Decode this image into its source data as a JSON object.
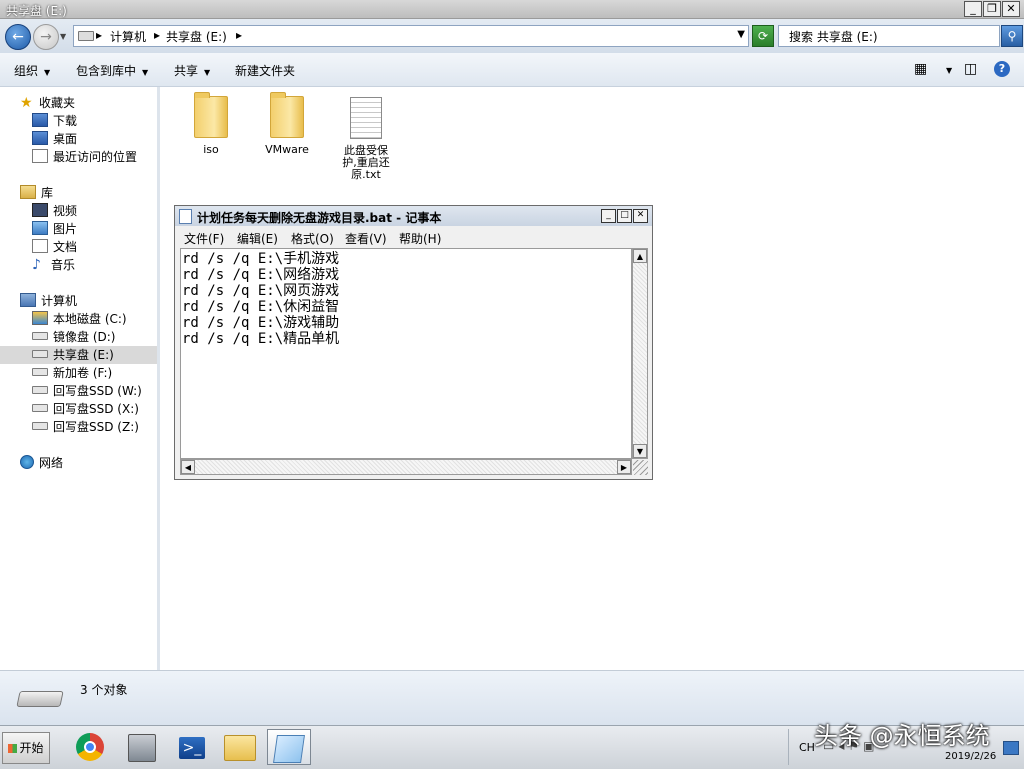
{
  "explorer": {
    "window_title": "共享盘 (E:)",
    "address": {
      "crumbs": [
        "计算机",
        "共享盘 (E:)"
      ]
    },
    "search_placeholder": "搜索 共享盘 (E:)",
    "toolbar": {
      "organize": "组织",
      "include_in_library": "包含到库中",
      "share": "共享",
      "new_folder": "新建文件夹"
    },
    "nav": {
      "favorites": "收藏夹",
      "favorites_items": [
        "下载",
        "桌面",
        "最近访问的位置"
      ],
      "libraries": "库",
      "library_items": [
        "视频",
        "图片",
        "文档",
        "音乐"
      ],
      "computer": "计算机",
      "drives": [
        "本地磁盘 (C:)",
        "镜像盘 (D:)",
        "共享盘 (E:)",
        "新加卷 (F:)",
        "回写盘SSD (W:)",
        "回写盘SSD (X:)",
        "回写盘SSD (Z:)"
      ],
      "selected_drive": "共享盘 (E:)",
      "network": "网络"
    },
    "files": [
      {
        "name": "iso",
        "type": "folder"
      },
      {
        "name": "VMware",
        "type": "folder"
      },
      {
        "name_lines": [
          "此盘受保",
          "护,重启还",
          "原.txt"
        ],
        "type": "text"
      }
    ],
    "status": {
      "item_count": "3 个对象"
    }
  },
  "notepad": {
    "title": "计划任务每天删除无盘游戏目录.bat - 记事本",
    "menu": [
      "文件(F)",
      "编辑(E)",
      "格式(O)",
      "查看(V)",
      "帮助(H)"
    ],
    "lines": [
      "rd /s /q E:\\手机游戏",
      "rd /s /q E:\\网络游戏",
      "rd /s /q E:\\网页游戏",
      "rd /s /q E:\\休闲益智",
      "rd /s /q E:\\游戏辅助",
      "rd /s /q E:\\精品单机"
    ]
  },
  "taskbar": {
    "start": "开始",
    "apps": [
      "chrome-icon",
      "server-manager-icon",
      "powershell-icon",
      "explorer-icon",
      "notepad-icon"
    ],
    "active_app": "notepad-icon",
    "lang": "CH",
    "date": "2019/2/26"
  },
  "watermark": "头条 @永恒系统",
  "colors": {
    "accent_blue": "#2c69c2",
    "selection_gray": "#d9d9d9"
  }
}
